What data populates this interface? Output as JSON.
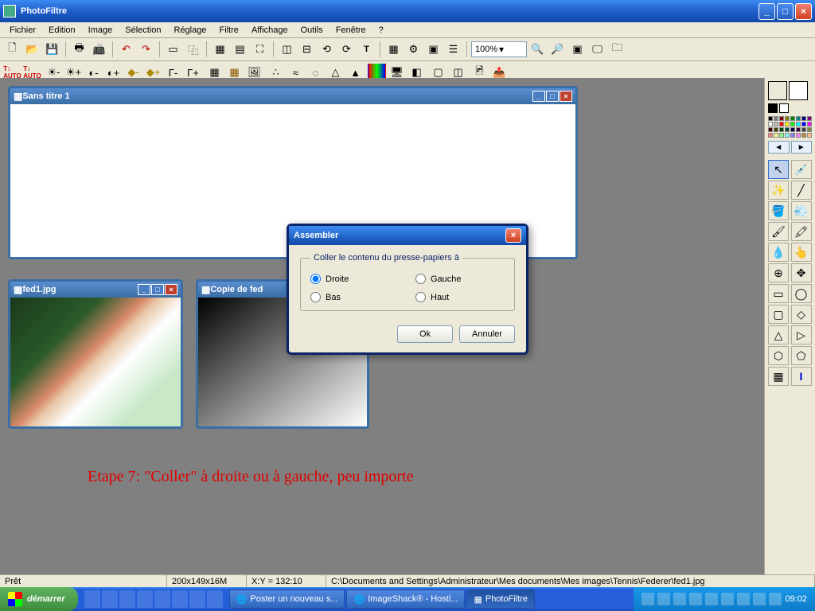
{
  "app": {
    "title": "PhotoFiltre"
  },
  "menu": [
    "Fichier",
    "Edition",
    "Image",
    "Sélection",
    "Réglage",
    "Filtre",
    "Affichage",
    "Outils",
    "Fenêtre",
    "?"
  ],
  "zoom": "100%",
  "windows": {
    "w1": {
      "title": "Sans titre 1"
    },
    "w2": {
      "title": "fed1.jpg"
    },
    "w3": {
      "title": "Copie de fed"
    }
  },
  "dialog": {
    "title": "Assembler",
    "legend": "Coller le contenu du presse-papiers à",
    "options": {
      "droite": "Droite",
      "gauche": "Gauche",
      "bas": "Bas",
      "haut": "Haut"
    },
    "ok": "Ok",
    "cancel": "Annuler"
  },
  "annotation": "Etape 7:  \"Coller\" à droite ou à gauche, peu importe",
  "status": {
    "ready": "Prêt",
    "dims": "200x149x16M",
    "coords": "X:Y = 132:10",
    "path": "C:\\Documents and Settings\\Administrateur\\Mes documents\\Mes images\\Tennis\\Federer\\fed1.jpg"
  },
  "taskbar": {
    "start": "démarrer",
    "tasks": [
      "Poster un nouveau s...",
      "ImageShack® - Hosti...",
      "PhotoFiltre"
    ],
    "clock": "09:02"
  },
  "palette_colors": [
    "#000",
    "#7f7f7f",
    "#800000",
    "#808000",
    "#008000",
    "#008080",
    "#000080",
    "#800080",
    "#fff",
    "#c0c0c0",
    "#f00",
    "#ff0",
    "#0f0",
    "#0ff",
    "#00f",
    "#f0f",
    "#400000",
    "#404000",
    "#004000",
    "#004040",
    "#000040",
    "#400040",
    "#404040",
    "#808040",
    "#ff8080",
    "#ffff80",
    "#80ff80",
    "#80ffff",
    "#8080ff",
    "#ff80ff",
    "#c08040",
    "#ffc080"
  ],
  "swatches": {
    "fg": "#ff0000",
    "bg": "#ffffff",
    "small1": "#000000",
    "small2": "#ffffff"
  }
}
